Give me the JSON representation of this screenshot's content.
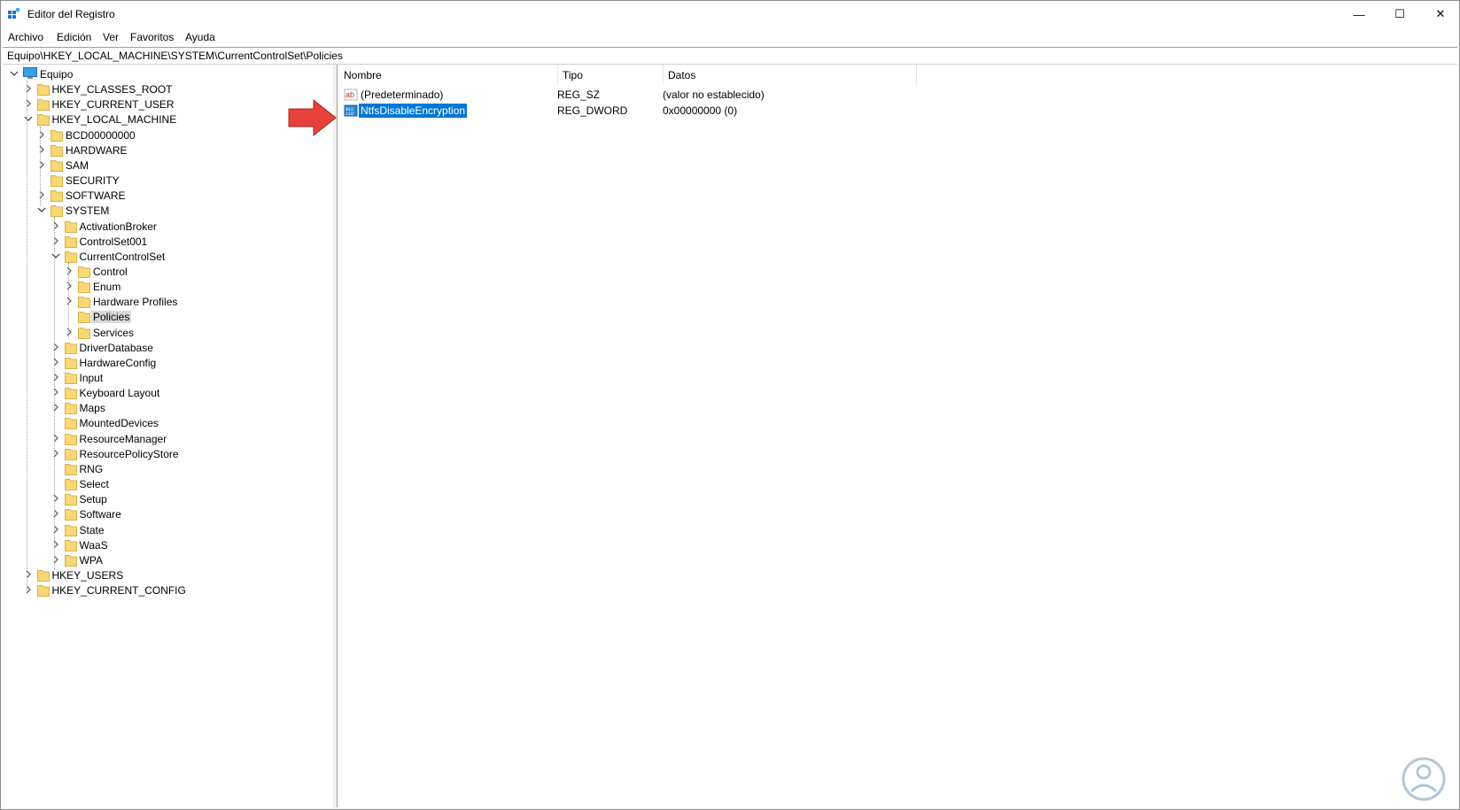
{
  "window": {
    "title": "Editor del Registro",
    "minimize": "—",
    "maximize": "☐",
    "close": "✕"
  },
  "menu": [
    "Archivo",
    "Edición",
    "Ver",
    "Favoritos",
    "Ayuda"
  ],
  "address": "Equipo\\HKEY_LOCAL_MACHINE\\SYSTEM\\CurrentControlSet\\Policies",
  "tree": {
    "root": "Equipo",
    "hkcr": "HKEY_CLASSES_ROOT",
    "hkcu": "HKEY_CURRENT_USER",
    "hklm": "HKEY_LOCAL_MACHINE",
    "hklm_children": [
      "BCD00000000",
      "HARDWARE",
      "SAM",
      "SECURITY",
      "SOFTWARE",
      "SYSTEM"
    ],
    "system_children_top": [
      "ActivationBroker",
      "ControlSet001",
      "CurrentControlSet"
    ],
    "ccs_children": [
      "Control",
      "Enum",
      "Hardware Profiles",
      "Policies",
      "Services"
    ],
    "system_children_bottom": [
      "DriverDatabase",
      "HardwareConfig",
      "Input",
      "Keyboard Layout",
      "Maps",
      "MountedDevices",
      "ResourceManager",
      "ResourcePolicyStore",
      "RNG",
      "Select",
      "Setup",
      "Software",
      "State",
      "WaaS",
      "WPA"
    ],
    "hku": "HKEY_USERS",
    "hkcc": "HKEY_CURRENT_CONFIG"
  },
  "columns": {
    "name": "Nombre",
    "type": "Tipo",
    "data": "Datos"
  },
  "values": [
    {
      "name": "(Predeterminado)",
      "type": "REG_SZ",
      "data": "(valor no establecido)",
      "icon": "string-value-icon"
    },
    {
      "name": "NtfsDisableEncryption",
      "type": "REG_DWORD",
      "data": "0x00000000 (0)",
      "icon": "binary-value-icon"
    }
  ],
  "colors": {
    "selection": "#0078d7",
    "folder": "#f8d775",
    "arrow": "#e8413c",
    "tree_selection": "#d9d9d9"
  }
}
